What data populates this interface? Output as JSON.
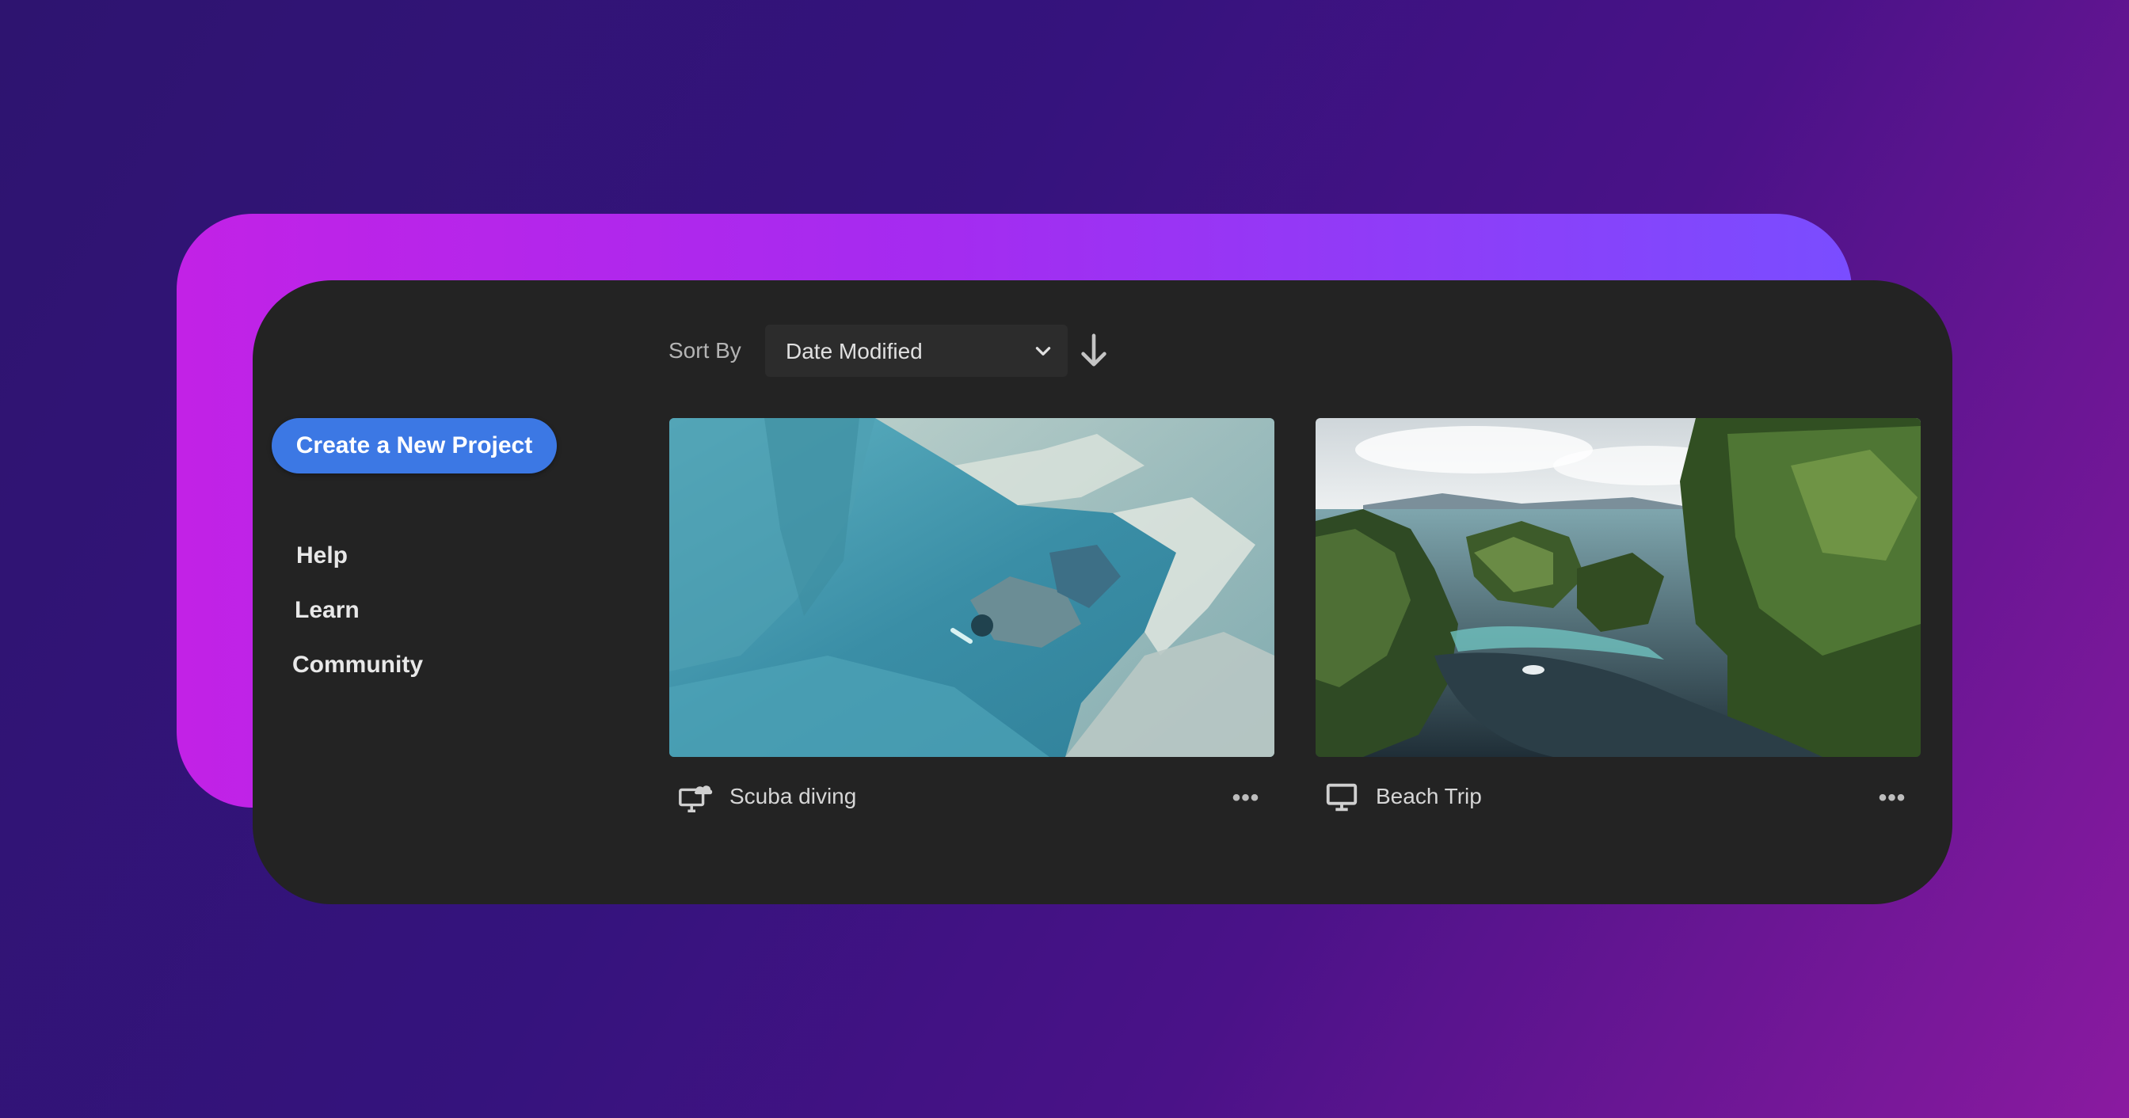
{
  "sidebar": {
    "create_button": "Create a New Project",
    "nav": [
      {
        "label": "Help"
      },
      {
        "label": "Learn"
      },
      {
        "label": "Community"
      }
    ]
  },
  "toolbar": {
    "sort_label": "Sort By",
    "sort_value": "Date Modified",
    "sort_direction": "descending"
  },
  "projects": [
    {
      "title": "Scuba diving",
      "icon": "cloud-sync-computer-icon",
      "more": "•••"
    },
    {
      "title": "Beach Trip",
      "icon": "computer-monitor-icon",
      "more": "•••"
    }
  ],
  "colors": {
    "accent": "#3c78e4",
    "panel": "#232323",
    "glow_start": "#c222e6",
    "glow_end": "#7a4dff"
  }
}
